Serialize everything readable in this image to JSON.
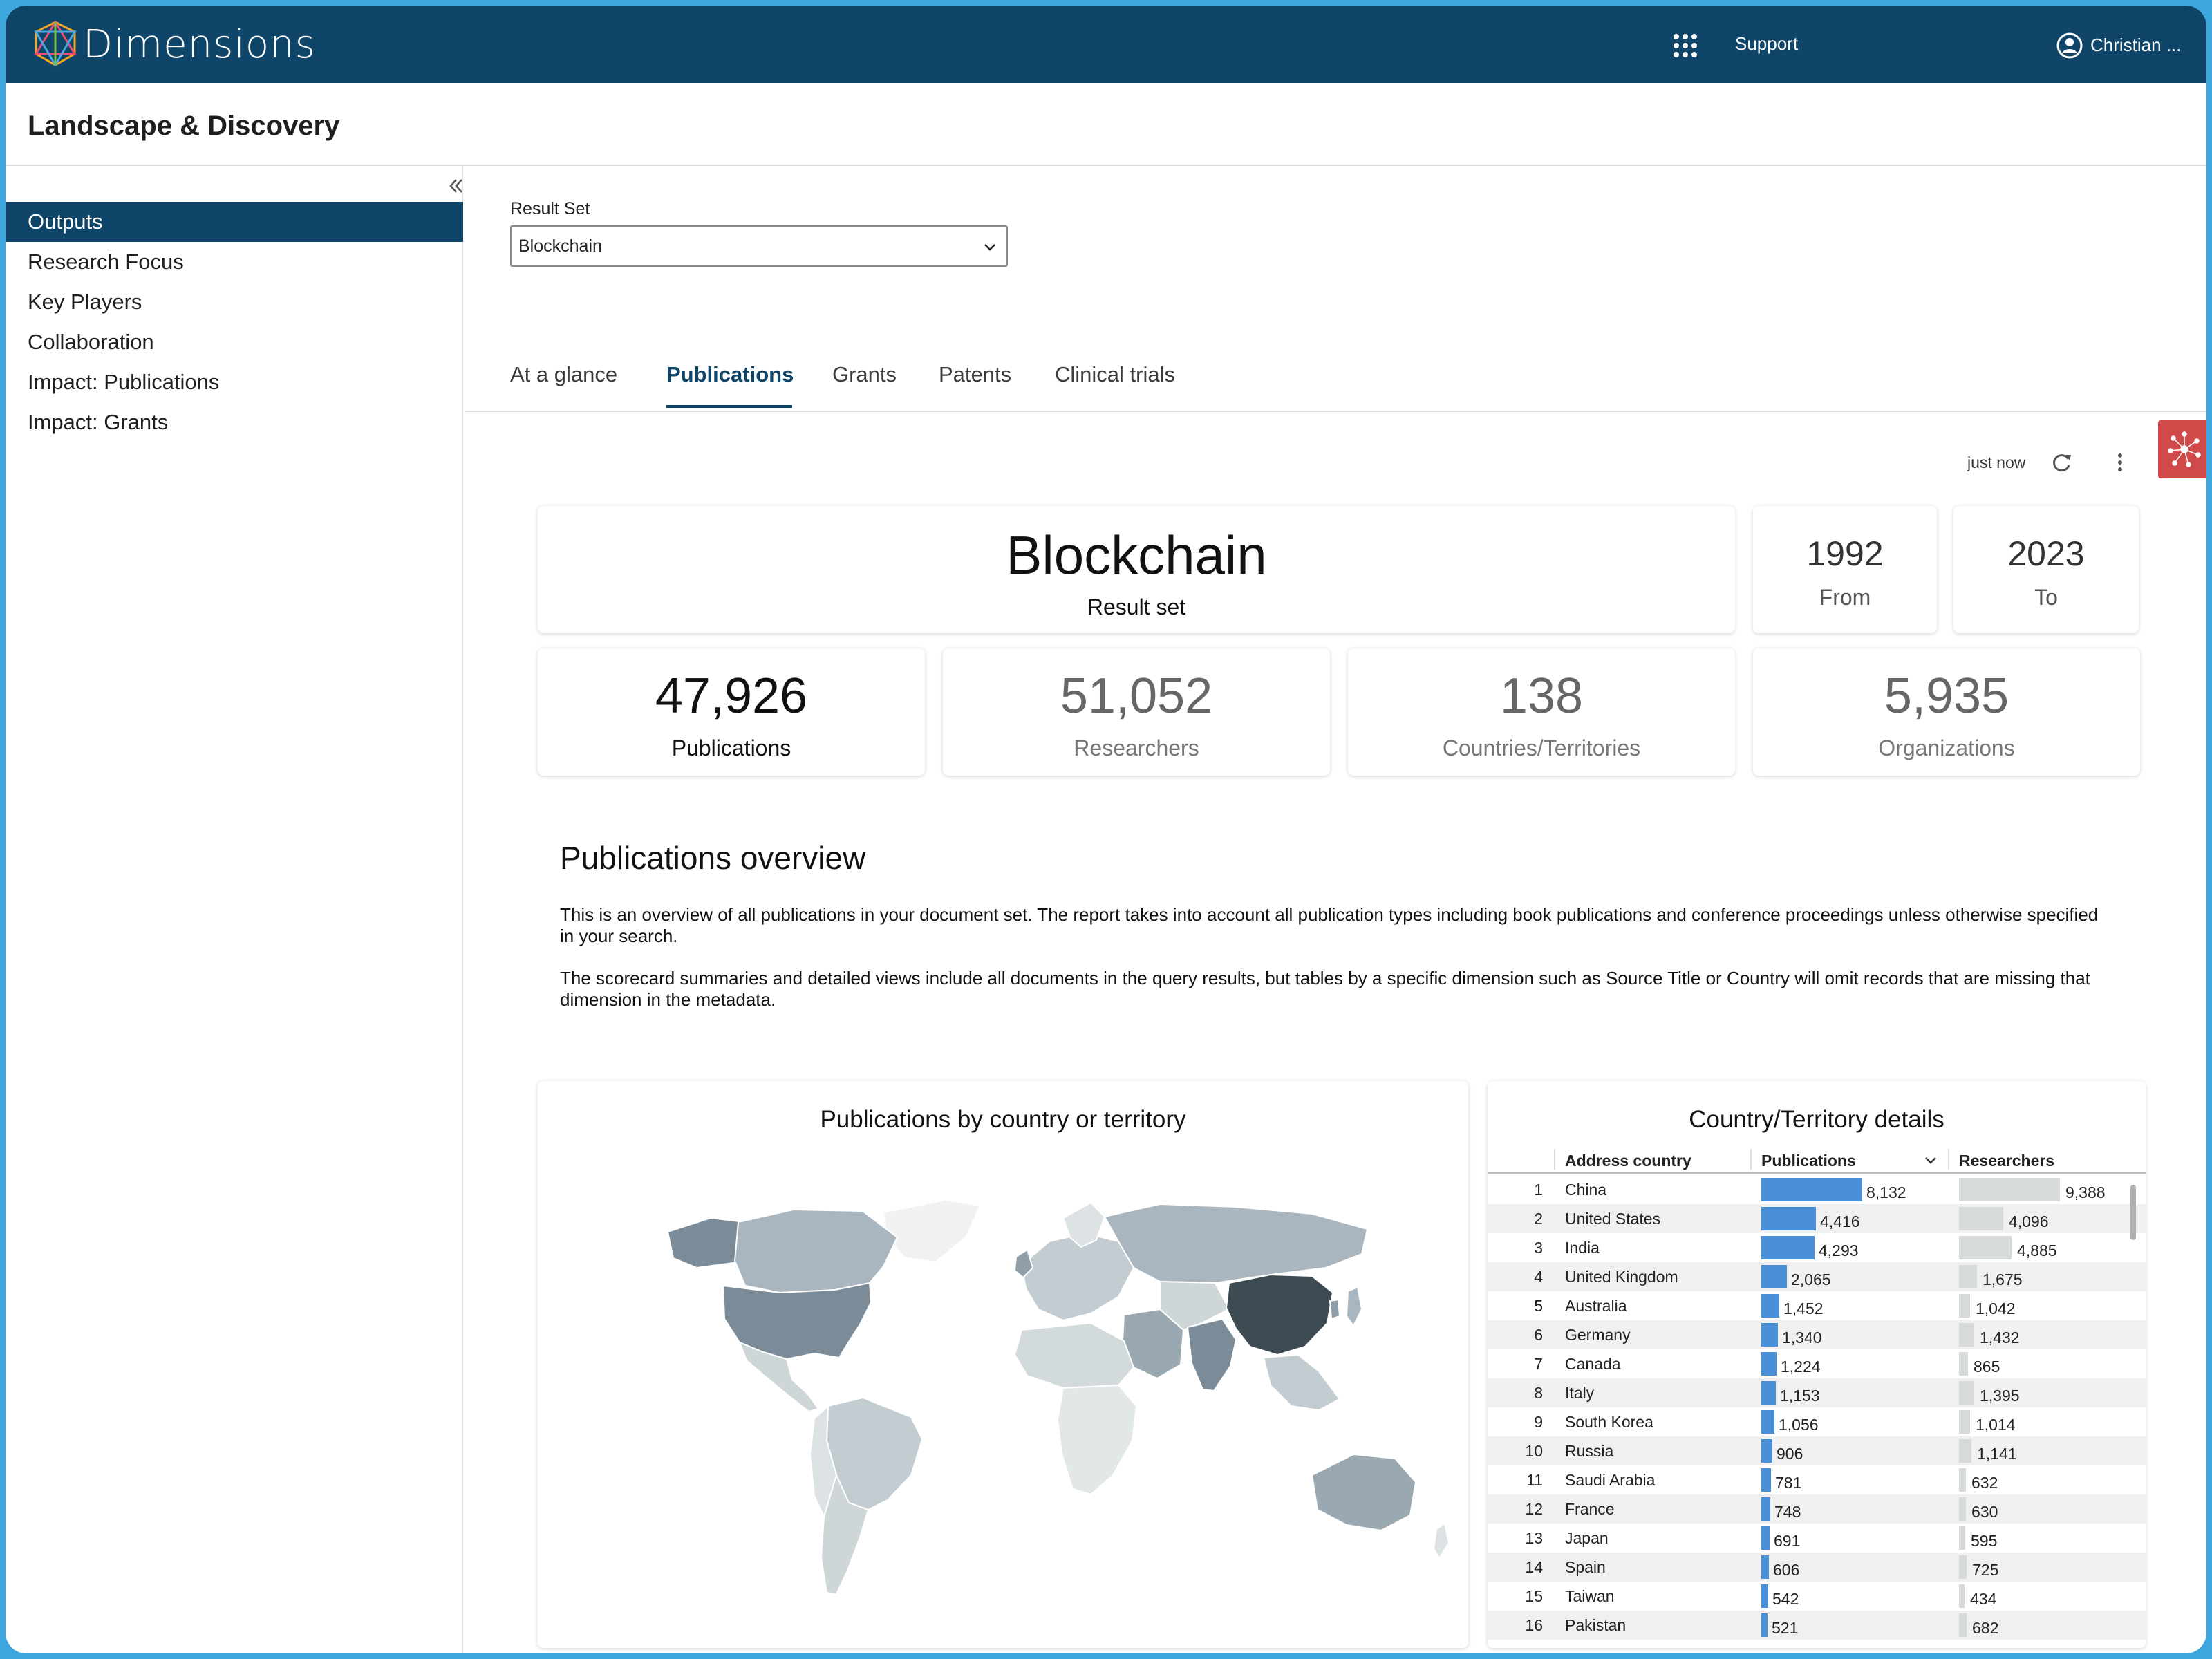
{
  "topbar": {
    "brand": "Dimensions",
    "support": "Support",
    "user": "Christian ..."
  },
  "app_title": "Landscape & Discovery",
  "sidebar": {
    "items": [
      {
        "label": "Outputs",
        "active": true
      },
      {
        "label": "Research Focus"
      },
      {
        "label": "Key Players"
      },
      {
        "label": "Collaboration"
      },
      {
        "label": "Impact: Publications"
      },
      {
        "label": "Impact: Grants"
      }
    ]
  },
  "result_set": {
    "label": "Result Set",
    "value": "Blockchain"
  },
  "tabs": [
    "At a glance",
    "Publications",
    "Grants",
    "Patents",
    "Clinical trials"
  ],
  "active_tab": "Publications",
  "refresh": {
    "text": "just now"
  },
  "scorecards": {
    "title": {
      "value": "Blockchain",
      "label": "Result set"
    },
    "from": {
      "value": "1992",
      "label": "From"
    },
    "to": {
      "value": "2023",
      "label": "To"
    },
    "publications": {
      "value": "47,926",
      "label": "Publications"
    },
    "researchers": {
      "value": "51,052",
      "label": "Researchers"
    },
    "countries": {
      "value": "138",
      "label": "Countries/Territories"
    },
    "organizations": {
      "value": "5,935",
      "label": "Organizations"
    }
  },
  "overview": {
    "title": "Publications overview",
    "para1": "This is an overview of all publications in your document set. The report takes into account all publication types including book publications and conference proceedings unless otherwise specified in your search.",
    "para2": "The scorecard summaries and detailed views include all documents in the query results, but tables by a specific dimension such as Source Title or Country will omit records that are missing that dimension in the metadata."
  },
  "map_panel": {
    "title": "Publications by country or territory"
  },
  "table_panel": {
    "title": "Country/Territory details",
    "columns": [
      "Address country",
      "Publications",
      "Researchers"
    ],
    "rows": [
      {
        "idx": "1",
        "country": "China",
        "publications": "8,132",
        "pubs_n": 8132,
        "researchers": "9,388",
        "res_n": 9388
      },
      {
        "idx": "2",
        "country": "United States",
        "publications": "4,416",
        "pubs_n": 4416,
        "researchers": "4,096",
        "res_n": 4096
      },
      {
        "idx": "3",
        "country": "India",
        "publications": "4,293",
        "pubs_n": 4293,
        "researchers": "4,885",
        "res_n": 4885
      },
      {
        "idx": "4",
        "country": "United Kingdom",
        "publications": "2,065",
        "pubs_n": 2065,
        "researchers": "1,675",
        "res_n": 1675
      },
      {
        "idx": "5",
        "country": "Australia",
        "publications": "1,452",
        "pubs_n": 1452,
        "researchers": "1,042",
        "res_n": 1042
      },
      {
        "idx": "6",
        "country": "Germany",
        "publications": "1,340",
        "pubs_n": 1340,
        "researchers": "1,432",
        "res_n": 1432
      },
      {
        "idx": "7",
        "country": "Canada",
        "publications": "1,224",
        "pubs_n": 1224,
        "researchers": "865",
        "res_n": 865
      },
      {
        "idx": "8",
        "country": "Italy",
        "publications": "1,153",
        "pubs_n": 1153,
        "researchers": "1,395",
        "res_n": 1395
      },
      {
        "idx": "9",
        "country": "South Korea",
        "publications": "1,056",
        "pubs_n": 1056,
        "researchers": "1,014",
        "res_n": 1014
      },
      {
        "idx": "10",
        "country": "Russia",
        "publications": "906",
        "pubs_n": 906,
        "researchers": "1,141",
        "res_n": 1141
      },
      {
        "idx": "11",
        "country": "Saudi Arabia",
        "publications": "781",
        "pubs_n": 781,
        "researchers": "632",
        "res_n": 632
      },
      {
        "idx": "12",
        "country": "France",
        "publications": "748",
        "pubs_n": 748,
        "researchers": "630",
        "res_n": 630
      },
      {
        "idx": "13",
        "country": "Japan",
        "publications": "691",
        "pubs_n": 691,
        "researchers": "595",
        "res_n": 595
      },
      {
        "idx": "14",
        "country": "Spain",
        "publications": "606",
        "pubs_n": 606,
        "researchers": "725",
        "res_n": 725
      },
      {
        "idx": "15",
        "country": "Taiwan",
        "publications": "542",
        "pubs_n": 542,
        "researchers": "434",
        "res_n": 434
      },
      {
        "idx": "16",
        "country": "Pakistan",
        "publications": "521",
        "pubs_n": 521,
        "researchers": "682",
        "res_n": 682
      }
    ]
  },
  "colors": {
    "brand_dark": "#0e4568",
    "pub_bar": "#4a90d9",
    "res_bar": "#d6dad9",
    "frame": "#3ea6de"
  }
}
